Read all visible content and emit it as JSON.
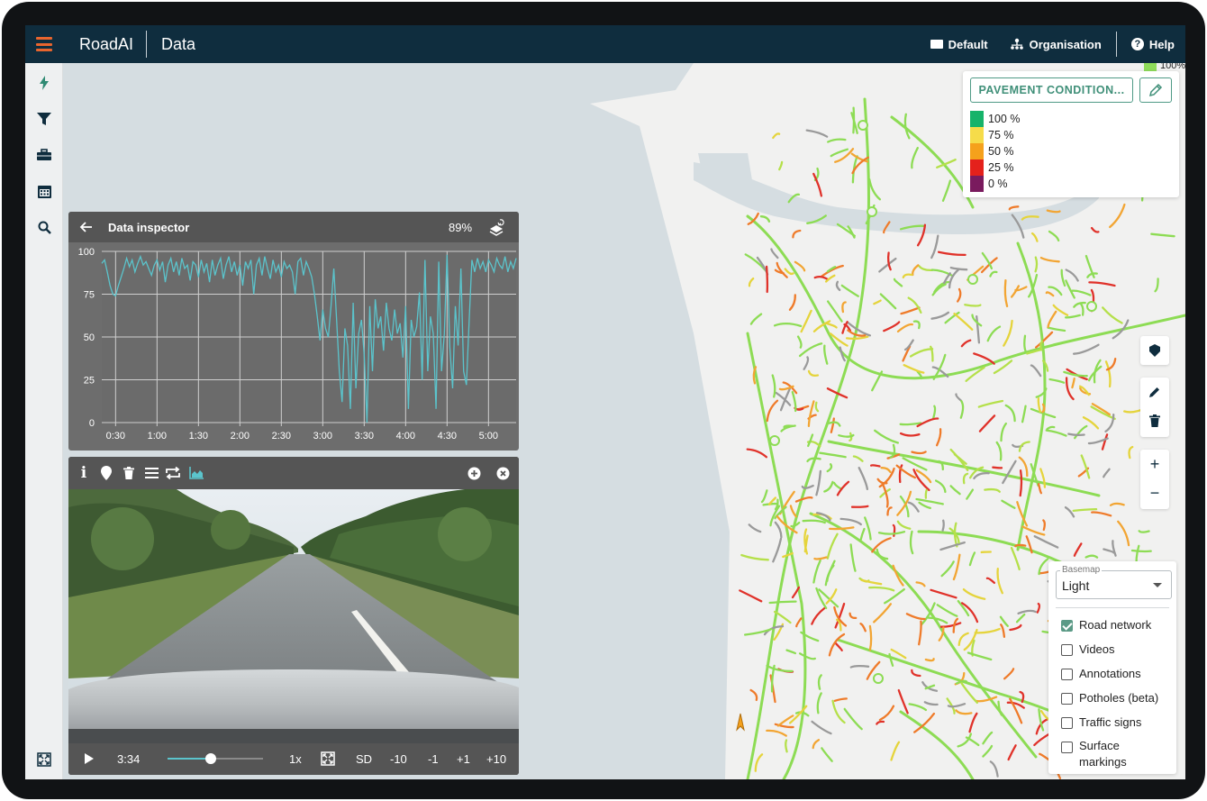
{
  "app": {
    "brand": "RoadAI",
    "page_title": "Data"
  },
  "topbar": {
    "workspace_label": "Default",
    "organisation_label": "Organisation",
    "help_label": "Help",
    "help_glyph": "?"
  },
  "sidebar": {
    "items": [
      {
        "name": "lightning-icon"
      },
      {
        "name": "filter-icon"
      },
      {
        "name": "toolbox-icon"
      },
      {
        "name": "calendar-icon"
      },
      {
        "name": "search-icon"
      }
    ],
    "bottom": {
      "name": "fullscreen-icon"
    }
  },
  "legend": {
    "layer_button_label": "PAVEMENT CONDITION...",
    "peek_label": "100%",
    "entries": [
      {
        "label": "100 %",
        "color": "#17b36a"
      },
      {
        "label": "75 %",
        "color": "#f6dc4a"
      },
      {
        "label": "50 %",
        "color": "#f5a11c"
      },
      {
        "label": "25 %",
        "color": "#e4211c"
      },
      {
        "label": "0 %",
        "color": "#7a1b5e"
      }
    ]
  },
  "map_tools": {
    "zoom_in": "+",
    "zoom_out": "−"
  },
  "basemap": {
    "label": "Basemap",
    "value": "Light",
    "layers": [
      {
        "label": "Road network",
        "checked": true
      },
      {
        "label": "Videos",
        "checked": false
      },
      {
        "label": "Annotations",
        "checked": false
      },
      {
        "label": "Potholes (beta)",
        "checked": false
      },
      {
        "label": "Traffic signs",
        "checked": false
      },
      {
        "label": "Surface markings",
        "checked": false
      }
    ]
  },
  "inspector": {
    "title": "Data inspector",
    "percent": "89%",
    "chart_data": {
      "type": "line",
      "title": "",
      "xlabel": "",
      "ylabel": "",
      "ylim": [
        0,
        100
      ],
      "yticks": [
        "100",
        "75",
        "50",
        "25",
        "0"
      ],
      "xticks": [
        "0:30",
        "1:00",
        "1:30",
        "2:00",
        "2:30",
        "3:00",
        "3:30",
        "4:00",
        "4:30",
        "5:00"
      ],
      "xlim": [
        20,
        320
      ],
      "grid": true,
      "color": "#5bc4cc",
      "series": [
        {
          "name": "",
          "values": [
            [
              20,
              93
            ],
            [
              22,
              95
            ],
            [
              24,
              88
            ],
            [
              26,
              80
            ],
            [
              28,
              75
            ],
            [
              30,
              74
            ],
            [
              32,
              80
            ],
            [
              34,
              85
            ],
            [
              36,
              90
            ],
            [
              38,
              96
            ],
            [
              40,
              91
            ],
            [
              42,
              95
            ],
            [
              44,
              88
            ],
            [
              46,
              93
            ],
            [
              48,
              97
            ],
            [
              50,
              92
            ],
            [
              52,
              94
            ],
            [
              54,
              90
            ],
            [
              56,
              86
            ],
            [
              58,
              92
            ],
            [
              60,
              95
            ],
            [
              62,
              89
            ],
            [
              64,
              94
            ],
            [
              66,
              82
            ],
            [
              68,
              92
            ],
            [
              70,
              96
            ],
            [
              72,
              88
            ],
            [
              74,
              94
            ],
            [
              76,
              86
            ],
            [
              78,
              96
            ],
            [
              80,
              90
            ],
            [
              82,
              92
            ],
            [
              84,
              83
            ],
            [
              86,
              94
            ],
            [
              88,
              92
            ],
            [
              90,
              85
            ],
            [
              92,
              95
            ],
            [
              94,
              88
            ],
            [
              96,
              93
            ],
            [
              98,
              82
            ],
            [
              100,
              95
            ],
            [
              102,
              86
            ],
            [
              104,
              92
            ],
            [
              106,
              96
            ],
            [
              108,
              84
            ],
            [
              110,
              92
            ],
            [
              112,
              97
            ],
            [
              114,
              88
            ],
            [
              116,
              94
            ],
            [
              118,
              86
            ],
            [
              120,
              92
            ],
            [
              122,
              80
            ],
            [
              124,
              94
            ],
            [
              126,
              90
            ],
            [
              128,
              95
            ],
            [
              130,
              75
            ],
            [
              132,
              92
            ],
            [
              134,
              96
            ],
            [
              136,
              86
            ],
            [
              138,
              97
            ],
            [
              140,
              90
            ],
            [
              142,
              84
            ],
            [
              144,
              95
            ],
            [
              146,
              88
            ],
            [
              148,
              92
            ],
            [
              150,
              85
            ],
            [
              152,
              94
            ],
            [
              154,
              90
            ],
            [
              156,
              92
            ],
            [
              158,
              88
            ],
            [
              160,
              75
            ],
            [
              162,
              94
            ],
            [
              164,
              96
            ],
            [
              166,
              86
            ],
            [
              168,
              94
            ],
            [
              170,
              90
            ],
            [
              172,
              85
            ],
            [
              174,
              75
            ],
            [
              176,
              62
            ],
            [
              178,
              48
            ],
            [
              180,
              66
            ],
            [
              182,
              55
            ],
            [
              184,
              50
            ],
            [
              186,
              68
            ],
            [
              188,
              90
            ],
            [
              190,
              60
            ],
            [
              192,
              30
            ],
            [
              194,
              12
            ],
            [
              196,
              55
            ],
            [
              198,
              45
            ],
            [
              200,
              8
            ],
            [
              202,
              70
            ],
            [
              204,
              20
            ],
            [
              206,
              52
            ],
            [
              208,
              60
            ],
            [
              210,
              40
            ],
            [
              212,
              0
            ],
            [
              214,
              68
            ],
            [
              216,
              30
            ],
            [
              218,
              72
            ],
            [
              220,
              55
            ],
            [
              222,
              62
            ],
            [
              224,
              42
            ],
            [
              226,
              70
            ],
            [
              228,
              55
            ],
            [
              230,
              48
            ],
            [
              232,
              66
            ],
            [
              234,
              52
            ],
            [
              236,
              58
            ],
            [
              238,
              38
            ],
            [
              240,
              68
            ],
            [
              242,
              8
            ],
            [
              244,
              60
            ],
            [
              246,
              50
            ],
            [
              248,
              56
            ],
            [
              250,
              76
            ],
            [
              252,
              25
            ],
            [
              254,
              95
            ],
            [
              256,
              30
            ],
            [
              258,
              62
            ],
            [
              260,
              52
            ],
            [
              262,
              8
            ],
            [
              264,
              94
            ],
            [
              266,
              30
            ],
            [
              268,
              52
            ],
            [
              270,
              98
            ],
            [
              272,
              44
            ],
            [
              274,
              20
            ],
            [
              276,
              68
            ],
            [
              278,
              45
            ],
            [
              280,
              90
            ],
            [
              282,
              30
            ],
            [
              284,
              22
            ],
            [
              286,
              60
            ],
            [
              288,
              95
            ],
            [
              290,
              88
            ],
            [
              292,
              96
            ],
            [
              294,
              90
            ],
            [
              296,
              94
            ],
            [
              298,
              88
            ],
            [
              300,
              95
            ],
            [
              302,
              92
            ],
            [
              304,
              88
            ],
            [
              306,
              96
            ],
            [
              308,
              92
            ],
            [
              310,
              90
            ],
            [
              312,
              97
            ],
            [
              314,
              88
            ],
            [
              316,
              94
            ],
            [
              318,
              90
            ],
            [
              320,
              96
            ]
          ]
        }
      ]
    }
  },
  "video": {
    "time": "3:34",
    "progress": 0.45,
    "speed": "1x",
    "quality": "SD",
    "skip_back_10": "-10",
    "skip_back_1": "-1",
    "skip_fwd_1": "+1",
    "skip_fwd_10": "+10",
    "info_glyph": "i"
  }
}
